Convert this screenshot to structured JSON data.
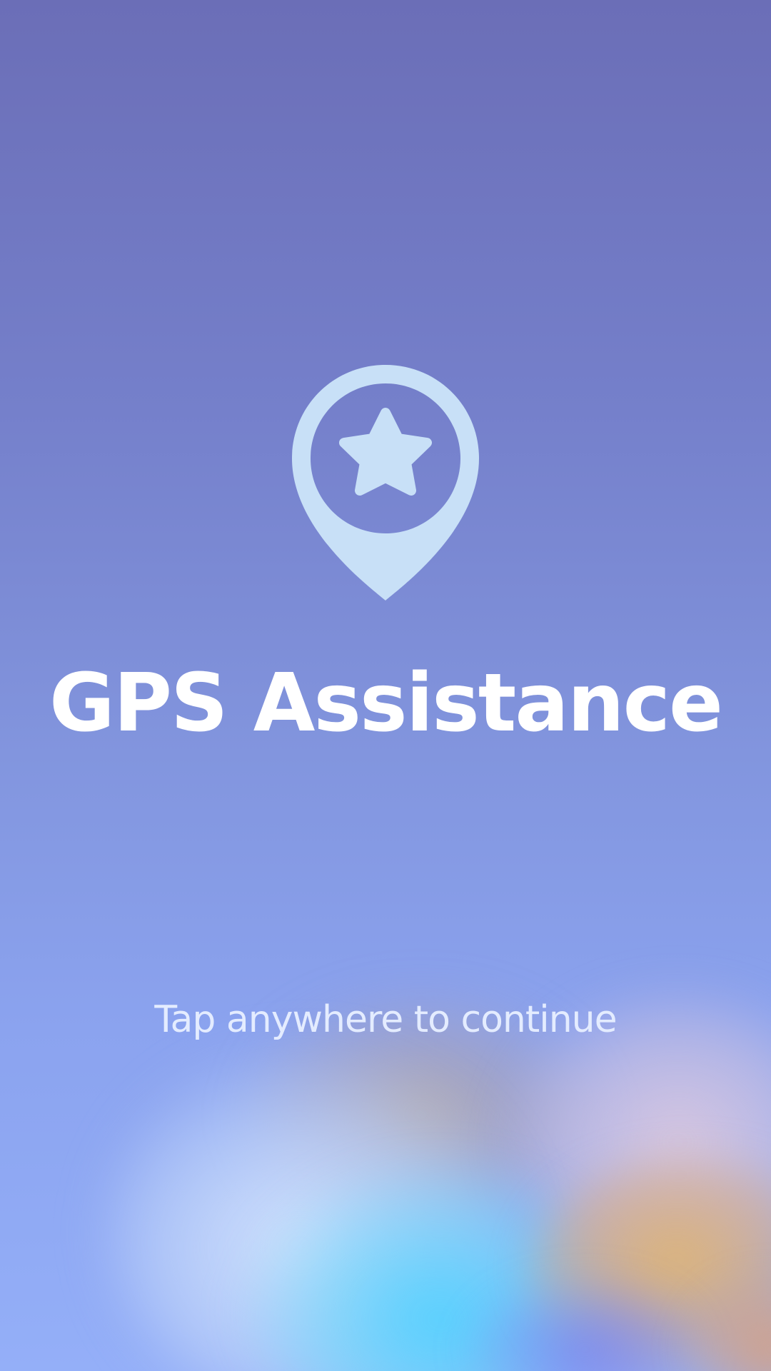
{
  "screen": {
    "title": "GPS Assistance",
    "hint": "Tap anywhere to continue",
    "logo_icon": "map-pin-star-icon"
  },
  "colors": {
    "background_top": "#6b6eb7",
    "background_bottom": "#94aff8",
    "logo_color": "#c8e0f7",
    "title_color": "#ffffff",
    "hint_color": "#e4ecff"
  }
}
